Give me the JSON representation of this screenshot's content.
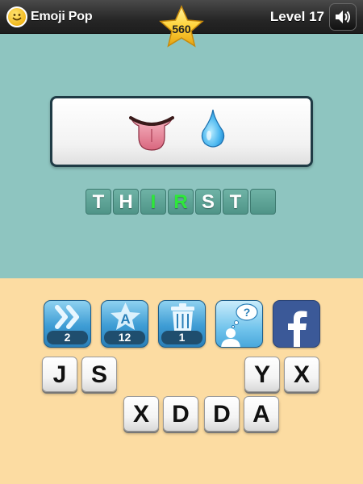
{
  "header": {
    "app_name": "Emoji Pop",
    "score": "560",
    "level_label": "Level 17"
  },
  "puzzle": {
    "emojis": [
      "tongue-emoji",
      "droplet-emoji"
    ],
    "answer": [
      {
        "letter": "T",
        "hint": false
      },
      {
        "letter": "H",
        "hint": false
      },
      {
        "letter": "I",
        "hint": true
      },
      {
        "letter": "R",
        "hint": true
      },
      {
        "letter": "S",
        "hint": false
      },
      {
        "letter": "T",
        "hint": false
      },
      {
        "letter": "",
        "hint": false
      }
    ]
  },
  "powerups": [
    {
      "name": "skip",
      "icon": "skip-icon",
      "count": "2"
    },
    {
      "name": "reveal-letter",
      "icon": "letter-star-icon",
      "count": "12"
    },
    {
      "name": "remove-letters",
      "icon": "trash-icon",
      "count": "1"
    },
    {
      "name": "ask-friend",
      "icon": "thinking-person-icon"
    },
    {
      "name": "facebook",
      "icon": "facebook-icon"
    }
  ],
  "keys": {
    "row1": [
      "J",
      "S",
      "",
      "",
      "Y",
      "X"
    ],
    "row2": [
      "X",
      "D",
      "D",
      "A"
    ]
  },
  "colors": {
    "top_background": "#8ec5c0",
    "bottom_background": "#fcdca2",
    "tile": "#5fa598",
    "hint_letter": "#2ee83a"
  }
}
